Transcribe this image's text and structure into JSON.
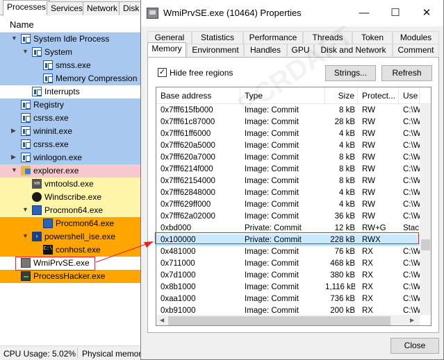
{
  "background_app": {
    "tabs": [
      "Processes",
      "Services",
      "Network",
      "Disk"
    ],
    "column_header": "Name",
    "processes": [
      {
        "name": "System Idle Process",
        "indent": 0,
        "expander": "open",
        "icon": "window-icon",
        "bg": "#a8c8f0"
      },
      {
        "name": "System",
        "indent": 1,
        "expander": "open",
        "icon": "window-icon",
        "bg": "#a8c8f0"
      },
      {
        "name": "smss.exe",
        "indent": 2,
        "expander": "",
        "icon": "window-icon",
        "bg": "#a8c8f0"
      },
      {
        "name": "Memory Compression",
        "indent": 2,
        "expander": "",
        "icon": "window-icon",
        "bg": "#a8c8f0"
      },
      {
        "name": "Interrupts",
        "indent": 1,
        "expander": "",
        "icon": "window-icon",
        "bg": "#ffffff"
      },
      {
        "name": "Registry",
        "indent": 0,
        "expander": "",
        "icon": "window-icon",
        "bg": "#a8c8f0"
      },
      {
        "name": "csrss.exe",
        "indent": 0,
        "expander": "",
        "icon": "window-icon",
        "bg": "#a8c8f0"
      },
      {
        "name": "wininit.exe",
        "indent": 0,
        "expander": "closed",
        "icon": "window-icon",
        "bg": "#a8c8f0"
      },
      {
        "name": "csrss.exe",
        "indent": 0,
        "expander": "",
        "icon": "window-icon",
        "bg": "#a8c8f0"
      },
      {
        "name": "winlogon.exe",
        "indent": 0,
        "expander": "closed",
        "icon": "window-icon",
        "bg": "#a8c8f0"
      },
      {
        "name": "explorer.exe",
        "indent": 0,
        "expander": "open",
        "icon": "folder-icon",
        "bg": "#f8c8d0"
      },
      {
        "name": "vmtoolsd.exe",
        "indent": 1,
        "expander": "",
        "icon": "vmtools-icon",
        "bg": "#fff5a8"
      },
      {
        "name": "Windscribe.exe",
        "indent": 1,
        "expander": "",
        "icon": "windscribe-icon",
        "bg": "#fff5a8"
      },
      {
        "name": "Procmon64.exe",
        "indent": 1,
        "expander": "open",
        "icon": "procmon-icon",
        "bg": "#fff5a8"
      },
      {
        "name": "Procmon64.exe",
        "indent": 2,
        "expander": "",
        "icon": "procmon-icon",
        "bg": "#ffa500"
      },
      {
        "name": "powershell_ise.exe",
        "indent": 1,
        "expander": "open",
        "icon": "powershell-icon",
        "bg": "#ffa500"
      },
      {
        "name": "conhost.exe",
        "indent": 2,
        "expander": "",
        "icon": "console-icon",
        "bg": "#ffa500"
      },
      {
        "name": "WmiPrvSE.exe",
        "indent": 0,
        "expander": "",
        "icon": "wmi-icon",
        "bg": "#ffffff"
      },
      {
        "name": "ProcessHacker.exe",
        "indent": 0,
        "expander": "",
        "icon": "processhacker-icon",
        "bg": "#ffa500"
      }
    ],
    "status": {
      "cpu": "CPU Usage: 5.02%",
      "physical": "Physical memor"
    }
  },
  "dialog": {
    "title": "WmiPrvSE.exe (10464) Properties",
    "window_buttons": {
      "minimize": "—",
      "maximize": "☐",
      "close": "✕"
    },
    "tabs_row1": [
      "General",
      "Statistics",
      "Performance",
      "Threads",
      "Token",
      "Modules"
    ],
    "tabs_row2": [
      "Memory",
      "Environment",
      "Handles",
      "GPU",
      "Disk and Network",
      "Comment"
    ],
    "active_tab": "Memory",
    "hide_free_label": "Hide free regions",
    "hide_free_checked": "✓",
    "strings_button": "Strings...",
    "refresh_button": "Refresh",
    "close_button": "Close",
    "columns": [
      "Base address",
      "Type",
      "Size",
      "Protect...",
      "Use"
    ],
    "rows": [
      [
        "0x7fff615fb000",
        "Image: Commit",
        "8 kB",
        "RW",
        "C:\\W"
      ],
      [
        "0x7fff61c87000",
        "Image: Commit",
        "28 kB",
        "RW",
        "C:\\W"
      ],
      [
        "0x7fff61ff6000",
        "Image: Commit",
        "4 kB",
        "RW",
        "C:\\W"
      ],
      [
        "0x7fff620a5000",
        "Image: Commit",
        "4 kB",
        "RW",
        "C:\\W"
      ],
      [
        "0x7fff620a7000",
        "Image: Commit",
        "8 kB",
        "RW",
        "C:\\W"
      ],
      [
        "0x7fff6214f000",
        "Image: Commit",
        "8 kB",
        "RW",
        "C:\\W"
      ],
      [
        "0x7fff62154000",
        "Image: Commit",
        "8 kB",
        "RW",
        "C:\\W"
      ],
      [
        "0x7fff62848000",
        "Image: Commit",
        "4 kB",
        "RW",
        "C:\\W"
      ],
      [
        "0x7fff629ff000",
        "Image: Commit",
        "4 kB",
        "RW",
        "C:\\W"
      ],
      [
        "0x7fff62a02000",
        "Image: Commit",
        "36 kB",
        "RW",
        "C:\\W"
      ],
      [
        "0xbd000",
        "Private: Commit",
        "12 kB",
        "RW+G",
        "Stac"
      ],
      [
        "0x100000",
        "Private: Commit",
        "228 kB",
        "RWX",
        ""
      ],
      [
        "0x481000",
        "Image: Commit",
        "76 kB",
        "RX",
        "C:\\W"
      ],
      [
        "0x711000",
        "Image: Commit",
        "468 kB",
        "RX",
        "C:\\W"
      ],
      [
        "0x7d1000",
        "Image: Commit",
        "380 kB",
        "RX",
        "C:\\W"
      ],
      [
        "0x8b1000",
        "Image: Commit",
        "1,116 kB",
        "RX",
        "C:\\W"
      ],
      [
        "0xaa1000",
        "Image: Commit",
        "736 kB",
        "RX",
        "C:\\W"
      ],
      [
        "0xb91000",
        "Image: Commit",
        "200 kB",
        "RX",
        "C:\\W"
      ]
    ],
    "selected_row": 11
  },
  "watermark": "PCRDAFT",
  "annotation_color": "#e8202a"
}
